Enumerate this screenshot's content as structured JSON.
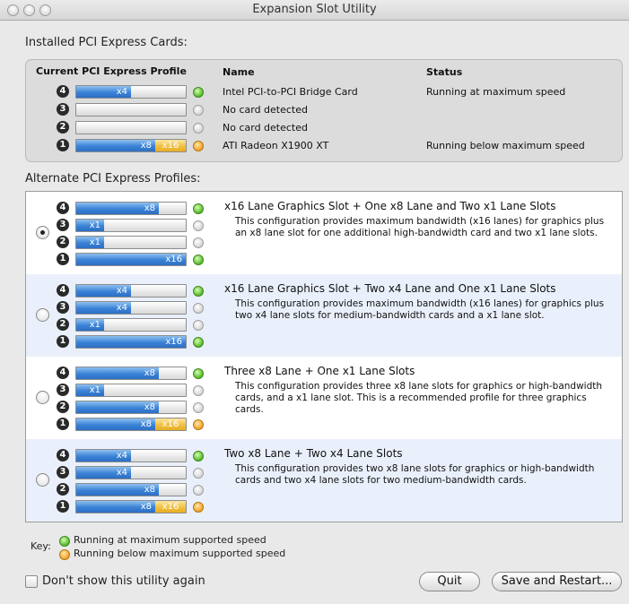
{
  "window": {
    "title": "Expansion Slot Utility"
  },
  "installed": {
    "label": "Installed PCI Express Cards:",
    "headers": {
      "profile": "Current PCI Express Profile",
      "name": "Name",
      "status": "Status"
    },
    "rows": [
      {
        "slot": "4",
        "lanes": [
          {
            "label": "x4",
            "fraction": 0.5,
            "color": "blue"
          }
        ],
        "light": "green",
        "name": "Intel PCI-to-PCI Bridge Card",
        "status": "Running at maximum speed"
      },
      {
        "slot": "3",
        "lanes": [],
        "light": "empty",
        "name": "No card detected",
        "status": ""
      },
      {
        "slot": "2",
        "lanes": [],
        "light": "empty",
        "name": "No card detected",
        "status": ""
      },
      {
        "slot": "1",
        "lanes": [
          {
            "label": "x8",
            "fraction": 0.72,
            "color": "blue"
          },
          {
            "label": "x16",
            "fraction": 0.28,
            "color": "orange"
          }
        ],
        "light": "orange",
        "name": "ATI Radeon X1900 XT",
        "status": "Running below maximum speed"
      }
    ]
  },
  "alternate": {
    "label": "Alternate PCI Express Profiles:",
    "profiles": [
      {
        "title": "x16 Lane Graphics Slot + One x8 Lane and Two x1 Lane Slots",
        "description": "This configuration provides maximum bandwidth (x16 lanes) for graphics plus an x8 lane slot for one additional high-bandwidth card and two x1 lane slots.",
        "selected": true,
        "slots": [
          {
            "slot": "4",
            "lanes": [
              {
                "label": "x8",
                "fraction": 0.75,
                "color": "blue"
              }
            ],
            "light": "green"
          },
          {
            "slot": "3",
            "lanes": [
              {
                "label": "x1",
                "fraction": 0.25,
                "color": "blue"
              }
            ],
            "light": "empty"
          },
          {
            "slot": "2",
            "lanes": [
              {
                "label": "x1",
                "fraction": 0.25,
                "color": "blue"
              }
            ],
            "light": "empty"
          },
          {
            "slot": "1",
            "lanes": [
              {
                "label": "x16",
                "fraction": 1.0,
                "color": "blue"
              }
            ],
            "light": "green"
          }
        ]
      },
      {
        "title": "x16 Lane Graphics Slot + Two x4 Lane and One x1 Lane Slots",
        "description": "This configuration provides maximum bandwidth (x16 lanes) for graphics plus two x4 lane slots for medium-bandwidth cards and a x1 lane slot.",
        "selected": false,
        "slots": [
          {
            "slot": "4",
            "lanes": [
              {
                "label": "x4",
                "fraction": 0.5,
                "color": "blue"
              }
            ],
            "light": "green"
          },
          {
            "slot": "3",
            "lanes": [
              {
                "label": "x4",
                "fraction": 0.5,
                "color": "blue"
              }
            ],
            "light": "empty"
          },
          {
            "slot": "2",
            "lanes": [
              {
                "label": "x1",
                "fraction": 0.25,
                "color": "blue"
              }
            ],
            "light": "empty"
          },
          {
            "slot": "1",
            "lanes": [
              {
                "label": "x16",
                "fraction": 1.0,
                "color": "blue"
              }
            ],
            "light": "green"
          }
        ]
      },
      {
        "title": "Three x8 Lane + One x1 Lane Slots",
        "description": "This configuration provides three x8 lane slots for graphics or high-bandwidth cards, and a x1 lane slot.  This is a recommended profile for three graphics cards.",
        "selected": false,
        "slots": [
          {
            "slot": "4",
            "lanes": [
              {
                "label": "x8",
                "fraction": 0.75,
                "color": "blue"
              }
            ],
            "light": "green"
          },
          {
            "slot": "3",
            "lanes": [
              {
                "label": "x1",
                "fraction": 0.25,
                "color": "blue"
              }
            ],
            "light": "empty"
          },
          {
            "slot": "2",
            "lanes": [
              {
                "label": "x8",
                "fraction": 0.75,
                "color": "blue"
              }
            ],
            "light": "empty"
          },
          {
            "slot": "1",
            "lanes": [
              {
                "label": "x8",
                "fraction": 0.72,
                "color": "blue"
              },
              {
                "label": "x16",
                "fraction": 0.28,
                "color": "orange"
              }
            ],
            "light": "orange"
          }
        ]
      },
      {
        "title": "Two x8 Lane + Two x4 Lane Slots",
        "description": "This configuration provides two x8 lane slots for graphics or high-bandwidth cards and two x4 lane slots for two medium-bandwidth cards.",
        "selected": false,
        "slots": [
          {
            "slot": "4",
            "lanes": [
              {
                "label": "x4",
                "fraction": 0.5,
                "color": "blue"
              }
            ],
            "light": "green"
          },
          {
            "slot": "3",
            "lanes": [
              {
                "label": "x4",
                "fraction": 0.5,
                "color": "blue"
              }
            ],
            "light": "empty"
          },
          {
            "slot": "2",
            "lanes": [
              {
                "label": "x8",
                "fraction": 0.75,
                "color": "blue"
              }
            ],
            "light": "empty"
          },
          {
            "slot": "1",
            "lanes": [
              {
                "label": "x8",
                "fraction": 0.72,
                "color": "blue"
              },
              {
                "label": "x16",
                "fraction": 0.28,
                "color": "orange"
              }
            ],
            "light": "orange"
          }
        ]
      }
    ]
  },
  "key": {
    "label": "Key:",
    "items": [
      {
        "light": "green",
        "text": "Running at maximum supported speed"
      },
      {
        "light": "orange",
        "text": "Running below maximum supported speed"
      }
    ]
  },
  "footer": {
    "checkbox_label": "Don't show this utility again",
    "quit_label": "Quit",
    "save_label": "Save and Restart..."
  }
}
